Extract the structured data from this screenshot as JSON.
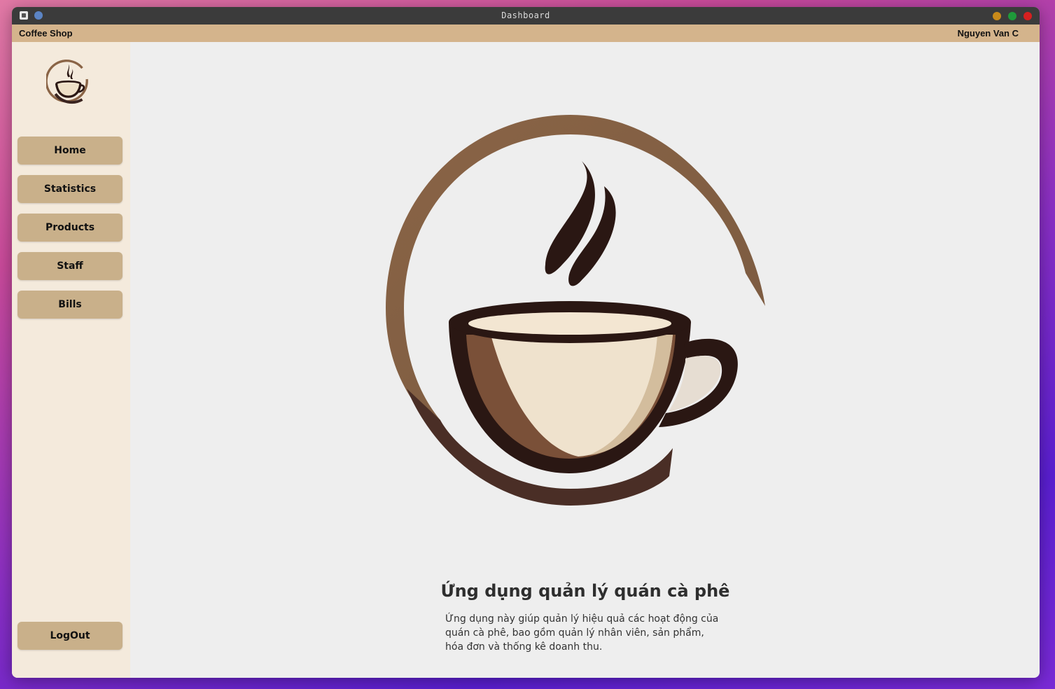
{
  "window": {
    "title": "Dashboard"
  },
  "menubar": {
    "shop_name": "Coffee Shop",
    "user_name": "Nguyen Van C"
  },
  "sidebar": {
    "items": [
      {
        "label": "Home"
      },
      {
        "label": "Statistics"
      },
      {
        "label": "Products"
      },
      {
        "label": "Staff"
      },
      {
        "label": "Bills"
      }
    ],
    "logout_label": "LogOut"
  },
  "main": {
    "heading": "Ứng dụng quản lý quán cà phê",
    "description": "Ứng dụng này giúp quản lý hiệu quả các hoạt động của quán cà phê, bao gồm quản lý nhân viên, sản phẩm, hóa đơn và thống kê doanh thu."
  },
  "colors": {
    "menubar": "#d4b48c",
    "sidebar": "#f4eadc",
    "button": "#c9b08a",
    "coffee_dark": "#2a1713",
    "coffee_ring": "#8a6446"
  },
  "icons": {
    "logo": "coffee-cup-icon"
  }
}
